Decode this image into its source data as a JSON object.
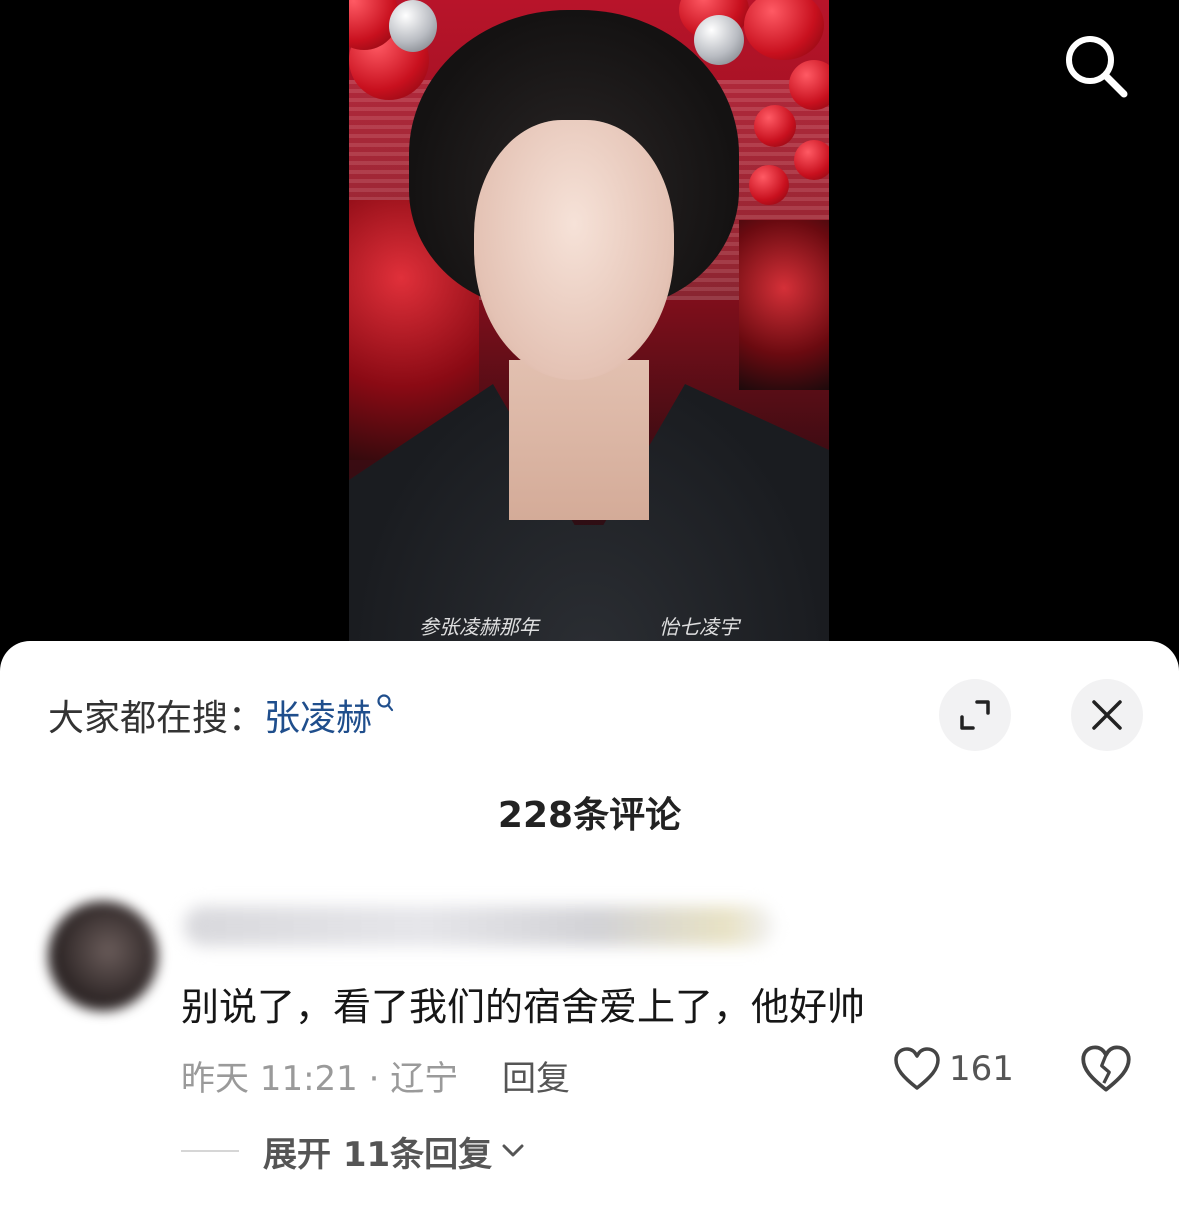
{
  "video": {
    "signature_left": "参张凌赫那年",
    "signature_right": "怡七凌宇"
  },
  "hot_search": {
    "prefix": "大家都在搜：",
    "keyword": "张凌赫"
  },
  "comments_header": {
    "count_label": "228条评论"
  },
  "comment": {
    "text": "别说了，看了我们的宿舍爱上了，他好帅",
    "time_location": "昨天 11:21 · 辽宁",
    "reply_label": "回复",
    "like_count": "161",
    "expand_label": "展开 11条回复"
  },
  "icons": {
    "search": "search-icon",
    "expand": "expand-icon",
    "close": "close-icon",
    "like": "heart-icon",
    "dislike": "broken-heart-icon",
    "chevron": "chevron-down-icon"
  },
  "colors": {
    "keyword": "#1f4e8c",
    "sheet_bg": "#ffffff",
    "meta_text": "#9a9a9a"
  }
}
